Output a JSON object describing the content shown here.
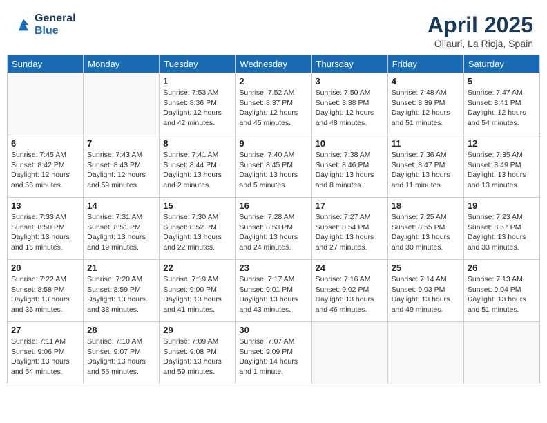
{
  "header": {
    "logo_line1": "General",
    "logo_line2": "Blue",
    "month_title": "April 2025",
    "location": "Ollauri, La Rioja, Spain"
  },
  "days_of_week": [
    "Sunday",
    "Monday",
    "Tuesday",
    "Wednesday",
    "Thursday",
    "Friday",
    "Saturday"
  ],
  "weeks": [
    [
      {
        "day": "",
        "info": ""
      },
      {
        "day": "",
        "info": ""
      },
      {
        "day": "1",
        "info": "Sunrise: 7:53 AM\nSunset: 8:36 PM\nDaylight: 12 hours and 42 minutes."
      },
      {
        "day": "2",
        "info": "Sunrise: 7:52 AM\nSunset: 8:37 PM\nDaylight: 12 hours and 45 minutes."
      },
      {
        "day": "3",
        "info": "Sunrise: 7:50 AM\nSunset: 8:38 PM\nDaylight: 12 hours and 48 minutes."
      },
      {
        "day": "4",
        "info": "Sunrise: 7:48 AM\nSunset: 8:39 PM\nDaylight: 12 hours and 51 minutes."
      },
      {
        "day": "5",
        "info": "Sunrise: 7:47 AM\nSunset: 8:41 PM\nDaylight: 12 hours and 54 minutes."
      }
    ],
    [
      {
        "day": "6",
        "info": "Sunrise: 7:45 AM\nSunset: 8:42 PM\nDaylight: 12 hours and 56 minutes."
      },
      {
        "day": "7",
        "info": "Sunrise: 7:43 AM\nSunset: 8:43 PM\nDaylight: 12 hours and 59 minutes."
      },
      {
        "day": "8",
        "info": "Sunrise: 7:41 AM\nSunset: 8:44 PM\nDaylight: 13 hours and 2 minutes."
      },
      {
        "day": "9",
        "info": "Sunrise: 7:40 AM\nSunset: 8:45 PM\nDaylight: 13 hours and 5 minutes."
      },
      {
        "day": "10",
        "info": "Sunrise: 7:38 AM\nSunset: 8:46 PM\nDaylight: 13 hours and 8 minutes."
      },
      {
        "day": "11",
        "info": "Sunrise: 7:36 AM\nSunset: 8:47 PM\nDaylight: 13 hours and 11 minutes."
      },
      {
        "day": "12",
        "info": "Sunrise: 7:35 AM\nSunset: 8:49 PM\nDaylight: 13 hours and 13 minutes."
      }
    ],
    [
      {
        "day": "13",
        "info": "Sunrise: 7:33 AM\nSunset: 8:50 PM\nDaylight: 13 hours and 16 minutes."
      },
      {
        "day": "14",
        "info": "Sunrise: 7:31 AM\nSunset: 8:51 PM\nDaylight: 13 hours and 19 minutes."
      },
      {
        "day": "15",
        "info": "Sunrise: 7:30 AM\nSunset: 8:52 PM\nDaylight: 13 hours and 22 minutes."
      },
      {
        "day": "16",
        "info": "Sunrise: 7:28 AM\nSunset: 8:53 PM\nDaylight: 13 hours and 24 minutes."
      },
      {
        "day": "17",
        "info": "Sunrise: 7:27 AM\nSunset: 8:54 PM\nDaylight: 13 hours and 27 minutes."
      },
      {
        "day": "18",
        "info": "Sunrise: 7:25 AM\nSunset: 8:55 PM\nDaylight: 13 hours and 30 minutes."
      },
      {
        "day": "19",
        "info": "Sunrise: 7:23 AM\nSunset: 8:57 PM\nDaylight: 13 hours and 33 minutes."
      }
    ],
    [
      {
        "day": "20",
        "info": "Sunrise: 7:22 AM\nSunset: 8:58 PM\nDaylight: 13 hours and 35 minutes."
      },
      {
        "day": "21",
        "info": "Sunrise: 7:20 AM\nSunset: 8:59 PM\nDaylight: 13 hours and 38 minutes."
      },
      {
        "day": "22",
        "info": "Sunrise: 7:19 AM\nSunset: 9:00 PM\nDaylight: 13 hours and 41 minutes."
      },
      {
        "day": "23",
        "info": "Sunrise: 7:17 AM\nSunset: 9:01 PM\nDaylight: 13 hours and 43 minutes."
      },
      {
        "day": "24",
        "info": "Sunrise: 7:16 AM\nSunset: 9:02 PM\nDaylight: 13 hours and 46 minutes."
      },
      {
        "day": "25",
        "info": "Sunrise: 7:14 AM\nSunset: 9:03 PM\nDaylight: 13 hours and 49 minutes."
      },
      {
        "day": "26",
        "info": "Sunrise: 7:13 AM\nSunset: 9:04 PM\nDaylight: 13 hours and 51 minutes."
      }
    ],
    [
      {
        "day": "27",
        "info": "Sunrise: 7:11 AM\nSunset: 9:06 PM\nDaylight: 13 hours and 54 minutes."
      },
      {
        "day": "28",
        "info": "Sunrise: 7:10 AM\nSunset: 9:07 PM\nDaylight: 13 hours and 56 minutes."
      },
      {
        "day": "29",
        "info": "Sunrise: 7:09 AM\nSunset: 9:08 PM\nDaylight: 13 hours and 59 minutes."
      },
      {
        "day": "30",
        "info": "Sunrise: 7:07 AM\nSunset: 9:09 PM\nDaylight: 14 hours and 1 minute."
      },
      {
        "day": "",
        "info": ""
      },
      {
        "day": "",
        "info": ""
      },
      {
        "day": "",
        "info": ""
      }
    ]
  ]
}
